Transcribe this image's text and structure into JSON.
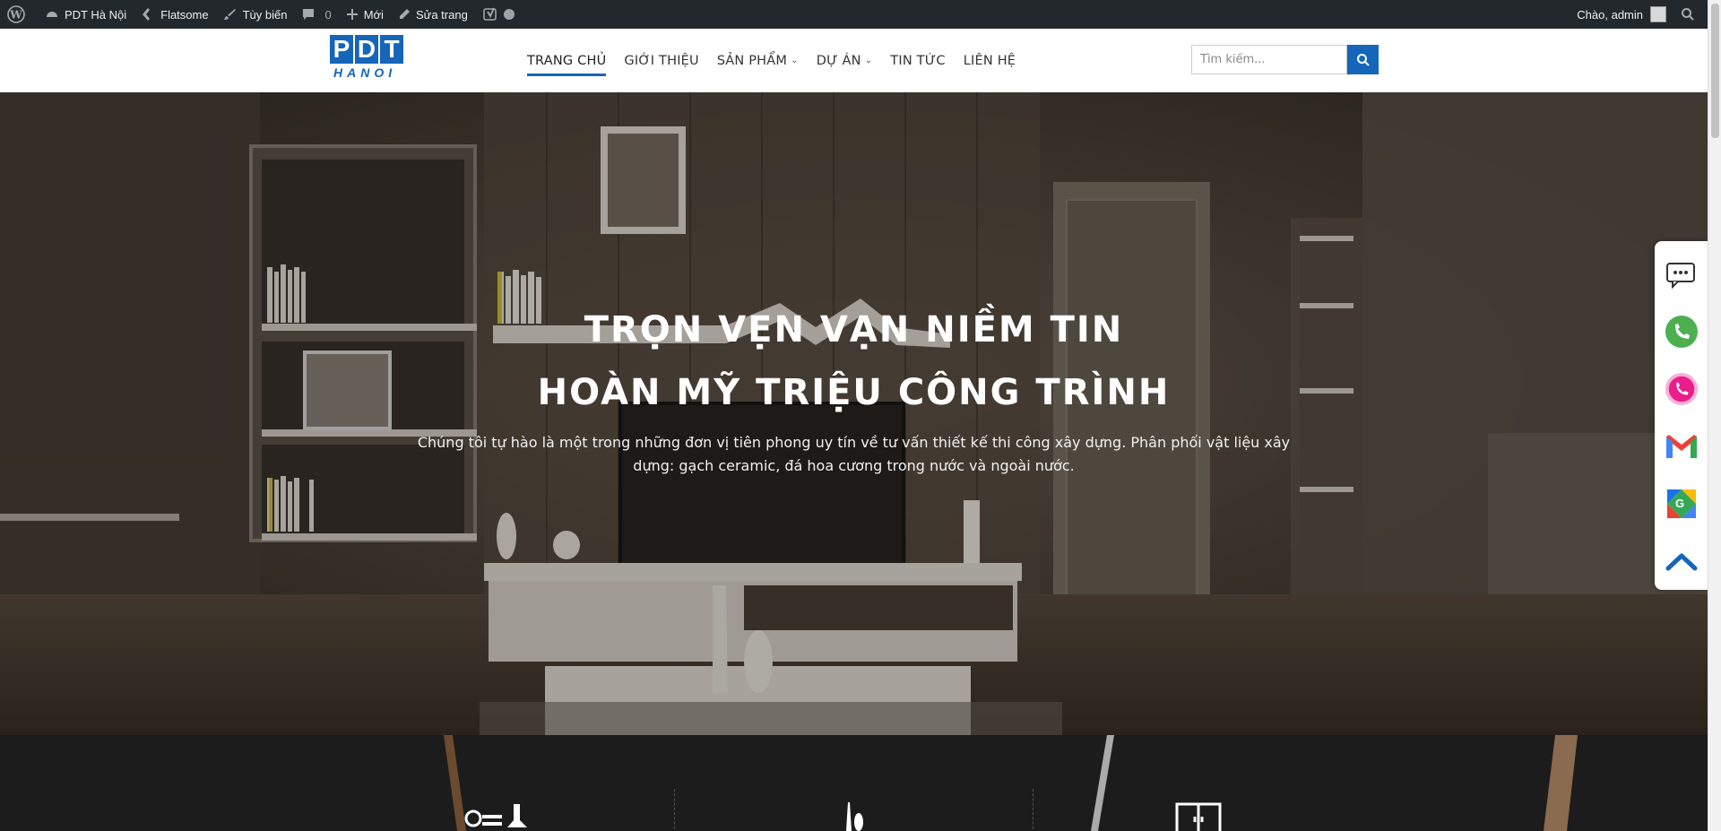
{
  "adminbar": {
    "site_name": "PDT Hà Nội",
    "theme": "Flatsome",
    "customize": "Tùy biến",
    "comments_count": "0",
    "new": "Mới",
    "edit_page": "Sửa trang",
    "greeting": "Chào, admin"
  },
  "header": {
    "logo_top": [
      "P",
      "D",
      "T"
    ],
    "logo_bottom": "HANOI",
    "nav": [
      {
        "label": "TRANG CHỦ",
        "active": true
      },
      {
        "label": "GIỚI THIỆU"
      },
      {
        "label": "SẢN PHẨM",
        "dropdown": true
      },
      {
        "label": "DỰ ÁN",
        "dropdown": true
      },
      {
        "label": "TIN TỨC"
      },
      {
        "label": "LIÊN HỆ"
      }
    ],
    "search_placeholder": "Tìm kiếm..."
  },
  "hero": {
    "title_line1": "TRỌN VẸN VẠN NIỀM TIN",
    "title_line2": "HOÀN MỸ TRIỆU CÔNG TRÌNH",
    "description": "Chúng tôi tự hào là một trong những đơn vị tiên phong uy tín về tư vấn thiết kế thi công xây dựng. Phân phối vật liệu xây dựng: gạch ceramic, đá hoa cương trong nước và ngoài nước."
  },
  "float_buttons": [
    "chat-icon",
    "phone-icon",
    "call-icon",
    "gmail-icon",
    "maps-icon",
    "scroll-top-icon"
  ],
  "colors": {
    "brand_blue": "#1565b8",
    "adminbar_bg": "#23282d",
    "phone_green": "#4caf50",
    "call_pink": "#e91e8c"
  }
}
